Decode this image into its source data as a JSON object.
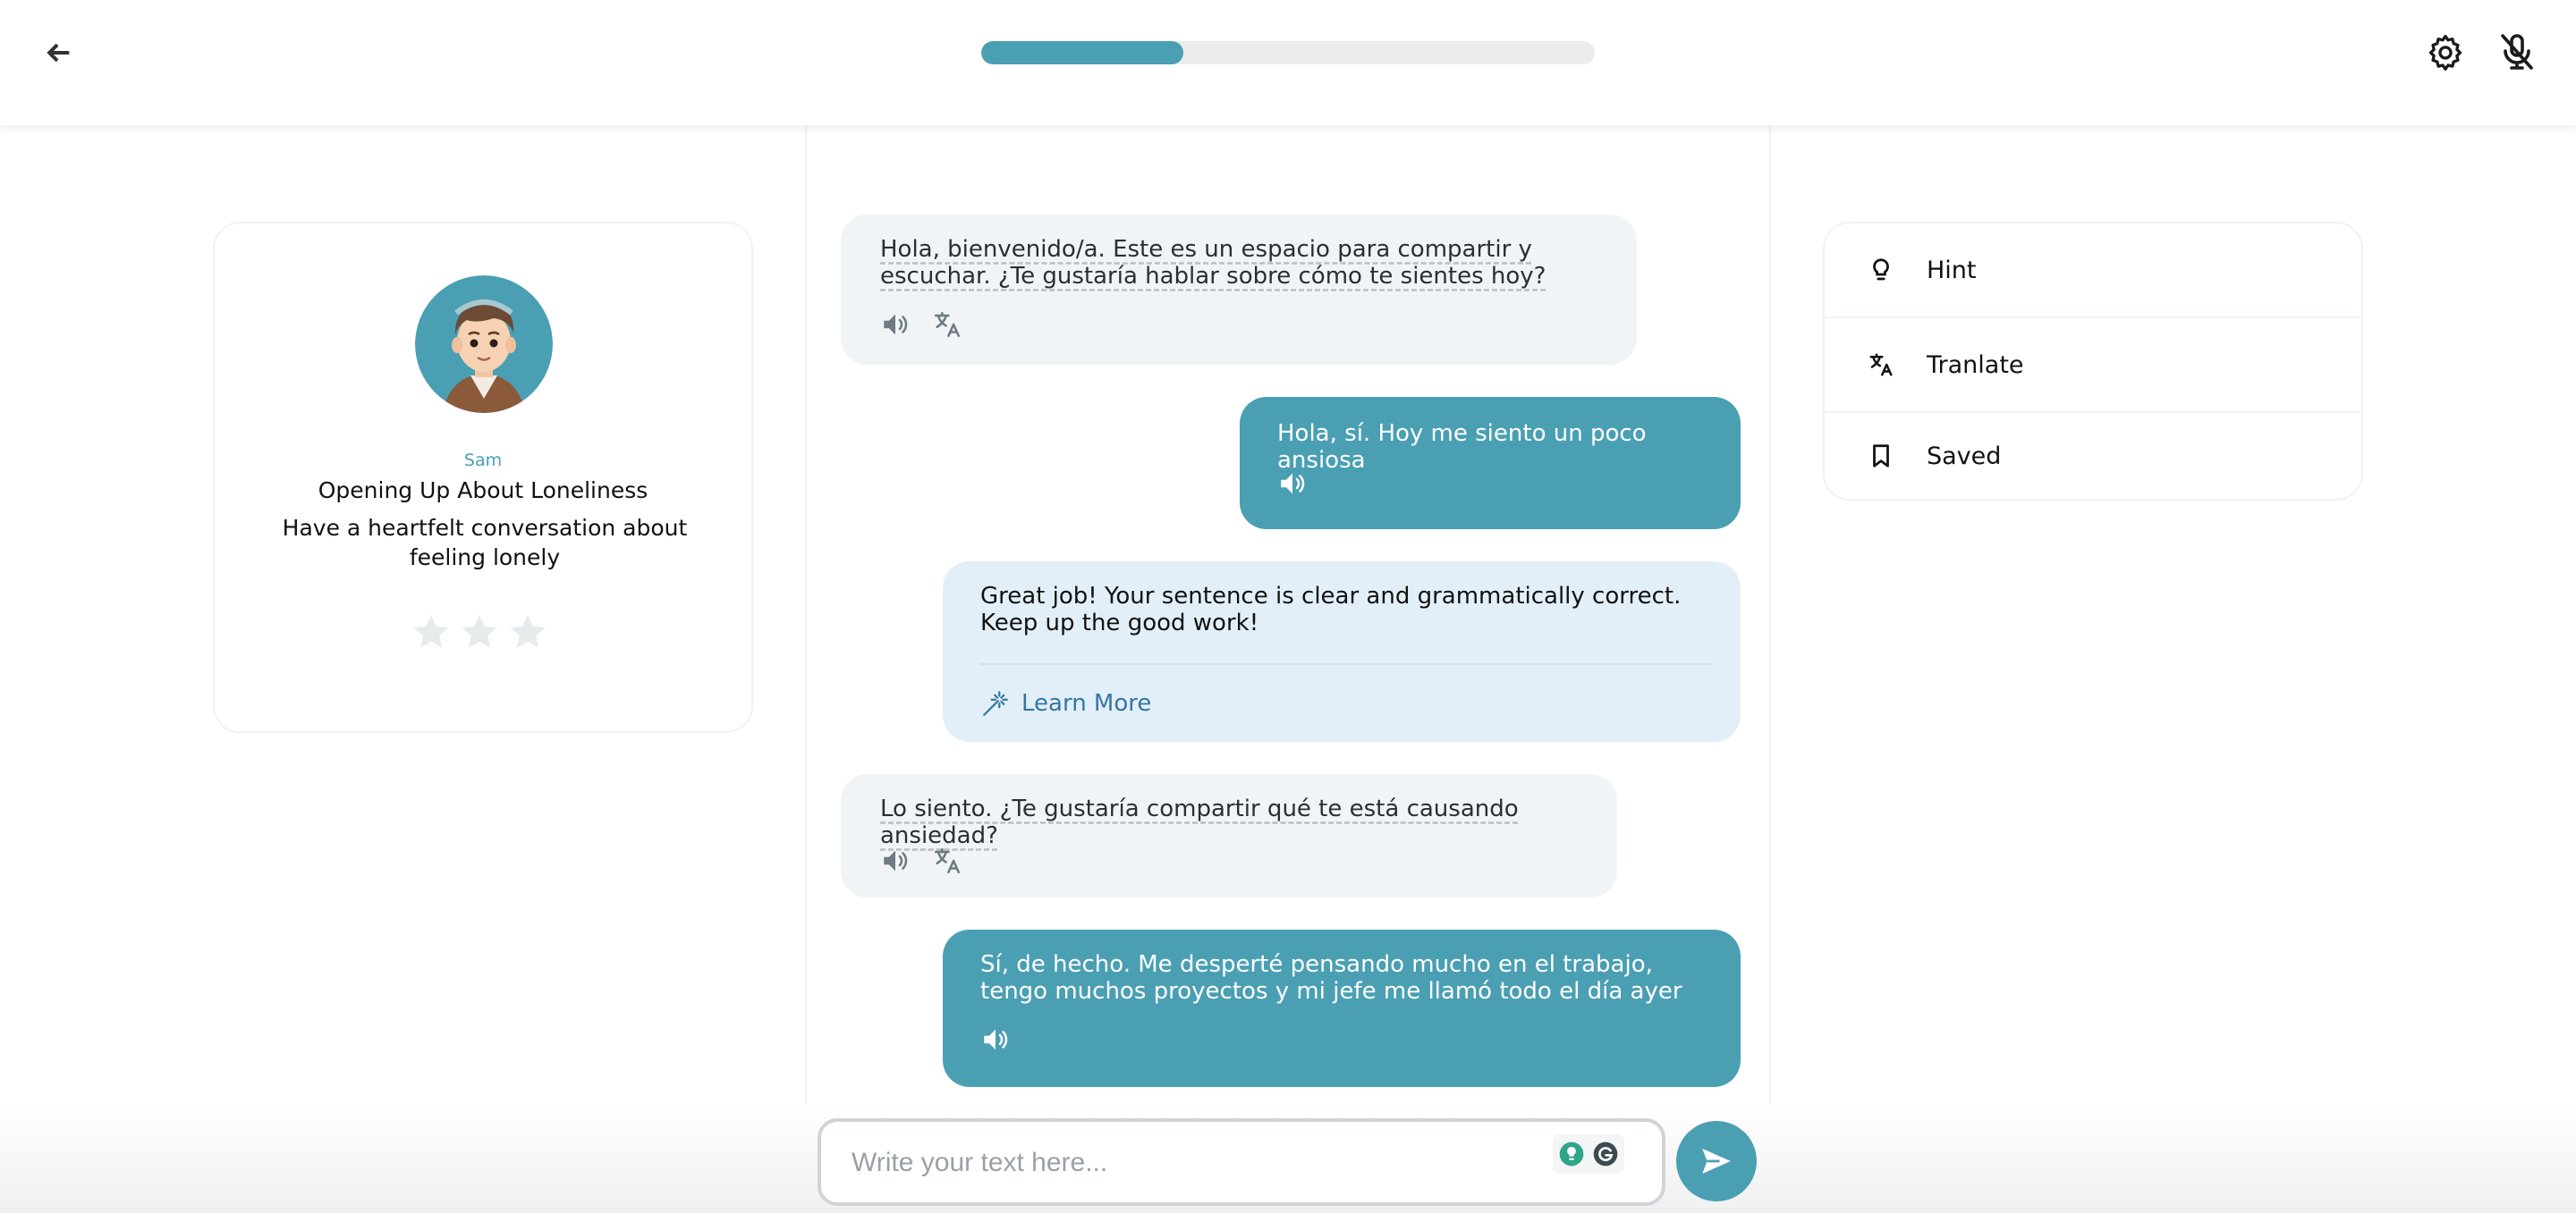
{
  "header": {
    "progress_fraction": 0.33
  },
  "profile": {
    "name": "Sam",
    "title": "Opening Up About Loneliness",
    "description": "Have a heartfelt conversation about feeling lonely",
    "rating": 0,
    "rating_max": 3
  },
  "messages": [
    {
      "role": "bot",
      "text": "Hola, bienvenido/a. Este es un espacio para compartir y escuchar. ¿Te gustaría hablar sobre cómo te sientes hoy?"
    },
    {
      "role": "user",
      "text": "Hola, sí. Hoy me siento un poco ansiosa"
    },
    {
      "role": "feedback",
      "text": "Great job! Your sentence is clear and grammatically correct. Keep up the good work!",
      "link_label": "Learn More"
    },
    {
      "role": "bot",
      "text": "Lo siento. ¿Te gustaría compartir qué te está causando ansiedad?"
    },
    {
      "role": "user",
      "text": "Sí, de hecho. Me desperté pensando mucho en el trabajo, tengo muchos proyectos y mi jefe me llamó todo el día ayer"
    }
  ],
  "side_menu": {
    "items": [
      {
        "label": "Hint",
        "icon": "lightbulb-icon"
      },
      {
        "label": "Tranlate",
        "icon": "translate-icon"
      },
      {
        "label": "Saved",
        "icon": "bookmark-icon"
      }
    ]
  },
  "composer": {
    "placeholder": "Write your text here...",
    "value": ""
  },
  "colors": {
    "accent": "#4a9fb3",
    "bot_bubble": "#f1f4f6",
    "feedback_bubble": "#e3eff8",
    "link": "#3477a3"
  }
}
